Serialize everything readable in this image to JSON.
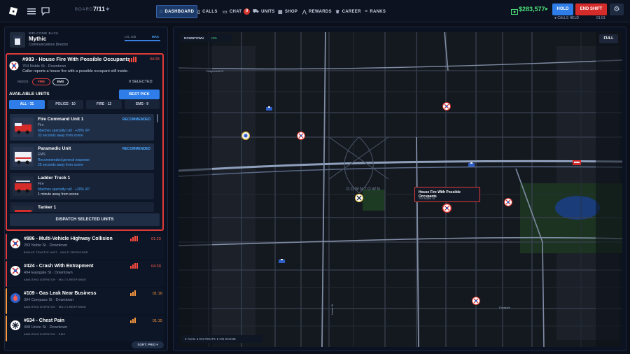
{
  "topbar": {
    "board_label": "BOARD",
    "board_value": "7/11",
    "board_star": "✦",
    "nav": [
      {
        "label": "DASHBOARD",
        "icon": "home-icon"
      },
      {
        "label": "CALLS",
        "icon": "phone-icon"
      },
      {
        "label": "CHAT",
        "icon": "chat-icon",
        "badge": "0"
      },
      {
        "label": "UNITS",
        "icon": "car-icon"
      },
      {
        "label": "SHOP",
        "icon": "shop-icon"
      },
      {
        "label": "REWARDS",
        "icon": "chart-icon"
      },
      {
        "label": "CAREER",
        "icon": "trophy-icon"
      },
      {
        "label": "RANKS",
        "icon": "ranks-icon"
      }
    ],
    "money": "$283,577",
    "money_arrow": "▸",
    "hold_label": "HOLD",
    "end_shift_label": "END SHIFT",
    "calls_held": "● CALLS HELD",
    "calls_timer": "01:01"
  },
  "profile": {
    "welcome": "WELCOME BACK",
    "name": "Mythic",
    "role": "Communications Director",
    "level_label": "LVL 100",
    "level_max": "MAX"
  },
  "active_call": {
    "title": "#983 - House Fire With Possible Occupants",
    "address": "764 Noble St  ·  Downtown",
    "description": "Caller reports a house fire with a possible occupant still inside.",
    "timer": "04:28",
    "needs_label": "NEEDS",
    "needs": [
      "FIRE",
      "EMS"
    ],
    "selected": "0 SELECTED",
    "available_label": "AVAILABLE UNITS",
    "best_pick": "BEST PICK",
    "filters": [
      "ALL · 31",
      "POLICE · 10",
      "FIRE · 12",
      "EMS · 9"
    ],
    "units": [
      {
        "name": "Fire Command Unit 1",
        "type": "Fire",
        "match": "Matches specialty call  ·  +20% XP",
        "eta": "33 seconds away from scene",
        "rec": "RECOMMENDED"
      },
      {
        "name": "Paramedic Unit",
        "type": "EMS",
        "match": "Recommended general response",
        "eta": "25 seconds away from scene",
        "rec": "RECOMMENDED"
      },
      {
        "name": "Ladder Truck 1",
        "type": "Fire",
        "match": "Matches specialty call  ·  +20% XP",
        "eta": "1 minute away from scene",
        "rec": ""
      },
      {
        "name": "Tanker 1",
        "type": "",
        "match": "",
        "eta": "",
        "rec": ""
      }
    ],
    "dispatch_label": "DISPATCH SELECTED UNITS"
  },
  "calls": [
    {
      "title": "#886 - Multi-Vehicle Highway Collision",
      "address": "293 Noble St  ·  Downtown",
      "tags": "BONUS TRAFFIC UNIT  ·  MULTI-RESPONSE",
      "timer": "01:23",
      "color": "#e03a3a"
    },
    {
      "title": "#424 - Crash With Entrapment",
      "address": "494 Eastgate St  ·  Downtown",
      "tags": "AWAITING DISPATCH  ·  MULTI-RESPONSE",
      "timer": "04:30",
      "color": "#e03a3a"
    },
    {
      "title": "#109 - Gas Leak Near Business",
      "address": "394 Compass St  ·  Downtown",
      "tags": "AWAITING DISPATCH  ·  MULTI-RESPONSE",
      "timer": "01:16",
      "color": "#ff9a3d"
    },
    {
      "title": "#634 - Chest Pain",
      "address": "498 Union St  ·  Downtown",
      "tags": "AWAITING DISPATCH  ·  EMS",
      "timer": "01:15",
      "color": "#ff9a3d"
    }
  ],
  "sort_label": "SORT: PRIO ▾",
  "map": {
    "area_label": "DOWNTOWN",
    "area_pct": "+0%",
    "full_label": "FULL",
    "district": "DOWNTOWN",
    "popup_title": "House Fire With Possible Occupants",
    "popup_sub": "764 Noble St",
    "legend": "● AVAIL   ● EN ROUTE   ● ON SCENE",
    "streets": [
      "Ridgecrest Dr",
      "Eastgate",
      "Union St"
    ]
  }
}
